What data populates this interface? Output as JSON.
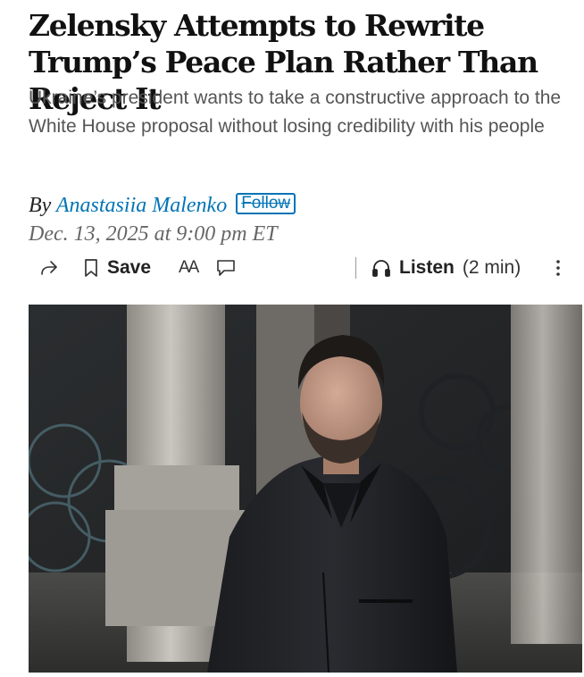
{
  "article": {
    "headline": "Zelensky Attempts to Rewrite Trump’s Peace Plan Rather Than Reject It",
    "dek": "Ukraine’s president wants to take a constructive approach to the White House proposal without losing credibility with his people",
    "byline_prefix": "By",
    "author": "Anastasiia Malenko",
    "follow_label": "Follow",
    "date": "Dec. 13, 2025 at 9:00 pm ET"
  },
  "toolbar": {
    "share_icon": "share-arrow-icon",
    "bookmark_icon": "bookmark-icon",
    "save_label": "Save",
    "text_size_label": "AA",
    "comment_icon": "comment-bubble-icon",
    "headphones_icon": "headphones-icon",
    "listen_label": "Listen",
    "listen_duration": "(2 min)",
    "more_icon": "vertical-ellipsis-icon"
  },
  "colors": {
    "link": "#0274b6",
    "headline": "#111111",
    "dek": "#555555",
    "date": "#666666"
  }
}
